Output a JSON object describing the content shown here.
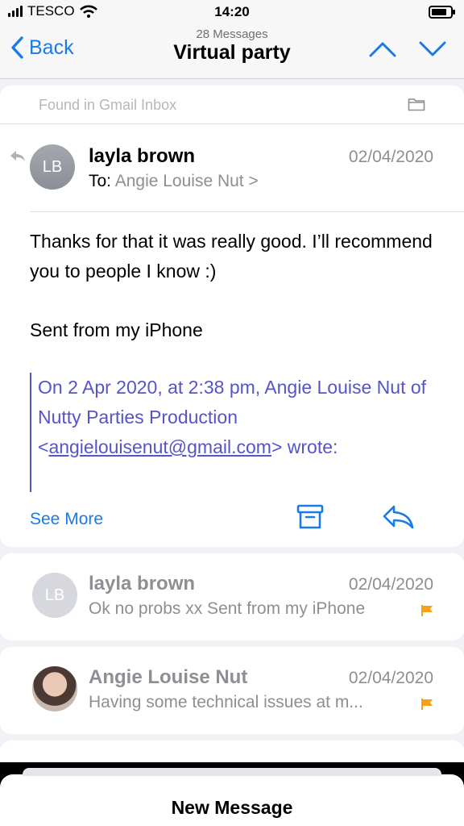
{
  "status": {
    "carrier": "TESCO",
    "time": "14:20",
    "battery_level": 0.75
  },
  "nav": {
    "back_label": "Back",
    "message_count": "28 Messages",
    "title": "Virtual party"
  },
  "found_in": "Found in Gmail Inbox",
  "main_message": {
    "avatar_initials": "LB",
    "sender": "layla brown",
    "date": "02/04/2020",
    "to_label": "To:",
    "to_name": "Angie Louise Nut >",
    "body_line1": "Thanks for that it was really good. I’ll recommend you to people I know :)",
    "body_line2": "Sent from my iPhone",
    "quote_prefix": "On 2 Apr 2020, at 2:38 pm, Angie Louise Nut of Nutty Parties Production <",
    "quote_email": "angielouisenut@gmail.com",
    "quote_suffix": "> wrote:",
    "see_more": "See More"
  },
  "thread": [
    {
      "avatar_initials": "LB",
      "sender": "layla brown",
      "date": "02/04/2020",
      "preview": "Ok no probs xx Sent from my iPhone",
      "flagged": true
    },
    {
      "sender": "Angie Louise Nut",
      "date": "02/04/2020",
      "preview": "Having some technical issues at m...",
      "flagged": true
    }
  ],
  "bottom": {
    "new_message": "New Message"
  },
  "colors": {
    "accent": "#1a7ae6",
    "quote": "#5654c9",
    "flag": "#f5a11c"
  }
}
